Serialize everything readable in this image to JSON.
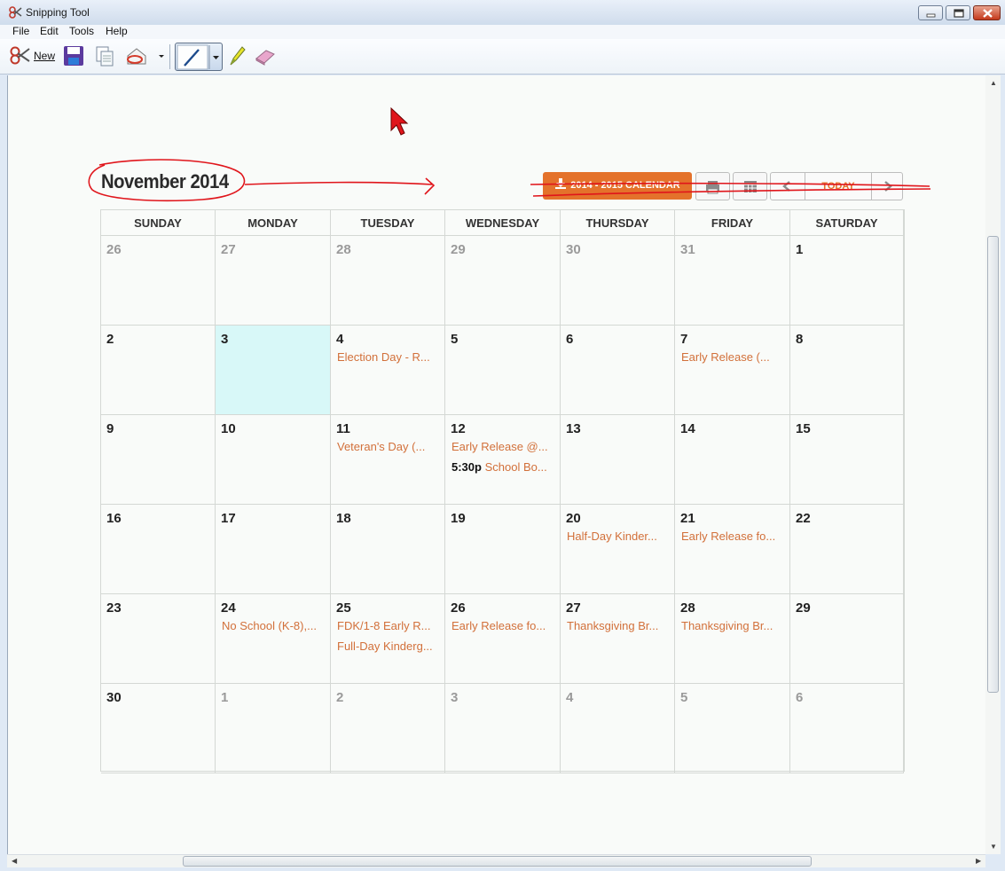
{
  "window": {
    "title": "Snipping Tool"
  },
  "menu": [
    "File",
    "Edit",
    "Tools",
    "Help"
  ],
  "toolbar": {
    "new_label": "New"
  },
  "calendar": {
    "month_title": "November 2014",
    "year_button": "2014 - 2015 CALENDAR",
    "today_button": "TODAY",
    "weekdays": [
      "SUNDAY",
      "MONDAY",
      "TUESDAY",
      "WEDNESDAY",
      "THURSDAY",
      "FRIDAY",
      "SATURDAY"
    ],
    "weeks": [
      [
        {
          "day": "26",
          "other": true,
          "events": []
        },
        {
          "day": "27",
          "other": true,
          "events": []
        },
        {
          "day": "28",
          "other": true,
          "events": []
        },
        {
          "day": "29",
          "other": true,
          "events": []
        },
        {
          "day": "30",
          "other": true,
          "events": []
        },
        {
          "day": "31",
          "other": true,
          "events": []
        },
        {
          "day": "1",
          "events": []
        }
      ],
      [
        {
          "day": "2",
          "events": []
        },
        {
          "day": "3",
          "today": true,
          "events": []
        },
        {
          "day": "4",
          "events": [
            {
              "text": "Election Day - R..."
            }
          ]
        },
        {
          "day": "5",
          "events": []
        },
        {
          "day": "6",
          "events": []
        },
        {
          "day": "7",
          "events": [
            {
              "text": "Early Release (..."
            }
          ]
        },
        {
          "day": "8",
          "events": []
        }
      ],
      [
        {
          "day": "9",
          "events": []
        },
        {
          "day": "10",
          "events": []
        },
        {
          "day": "11",
          "events": [
            {
              "text": "Veteran's Day (..."
            }
          ]
        },
        {
          "day": "12",
          "events": [
            {
              "text": "Early Release @..."
            },
            {
              "time": "5:30p",
              "text": "School Bo..."
            }
          ]
        },
        {
          "day": "13",
          "events": []
        },
        {
          "day": "14",
          "events": []
        },
        {
          "day": "15",
          "events": []
        }
      ],
      [
        {
          "day": "16",
          "events": []
        },
        {
          "day": "17",
          "events": []
        },
        {
          "day": "18",
          "events": []
        },
        {
          "day": "19",
          "events": []
        },
        {
          "day": "20",
          "events": [
            {
              "text": "Half-Day Kinder..."
            }
          ]
        },
        {
          "day": "21",
          "events": [
            {
              "text": "Early Release fo..."
            }
          ]
        },
        {
          "day": "22",
          "events": []
        }
      ],
      [
        {
          "day": "23",
          "events": []
        },
        {
          "day": "24",
          "events": [
            {
              "text": "No School (K-8),..."
            }
          ]
        },
        {
          "day": "25",
          "events": [
            {
              "text": "FDK/1-8 Early R..."
            },
            {
              "text": "Full-Day Kinderg..."
            }
          ]
        },
        {
          "day": "26",
          "events": [
            {
              "text": "Early Release fo..."
            }
          ]
        },
        {
          "day": "27",
          "events": [
            {
              "text": "Thanksgiving Br..."
            }
          ]
        },
        {
          "day": "28",
          "events": [
            {
              "text": "Thanksgiving Br..."
            }
          ]
        },
        {
          "day": "29",
          "events": []
        }
      ],
      [
        {
          "day": "30",
          "events": []
        },
        {
          "day": "1",
          "other": true,
          "events": []
        },
        {
          "day": "2",
          "other": true,
          "events": []
        },
        {
          "day": "3",
          "other": true,
          "events": []
        },
        {
          "day": "4",
          "other": true,
          "events": []
        },
        {
          "day": "5",
          "other": true,
          "events": []
        },
        {
          "day": "6",
          "other": true,
          "events": []
        }
      ]
    ]
  },
  "colors": {
    "accent": "#e4722b",
    "event": "#d2703a",
    "today_bg": "#d8f8f8",
    "annotation": "#e0151b"
  },
  "icons": [
    "scissors-icon",
    "save-icon",
    "copy-icon",
    "send-snip-icon",
    "pen-icon",
    "highlighter-icon",
    "eraser-icon",
    "print-icon",
    "calendar-icon",
    "mouse-cursor-icon"
  ]
}
